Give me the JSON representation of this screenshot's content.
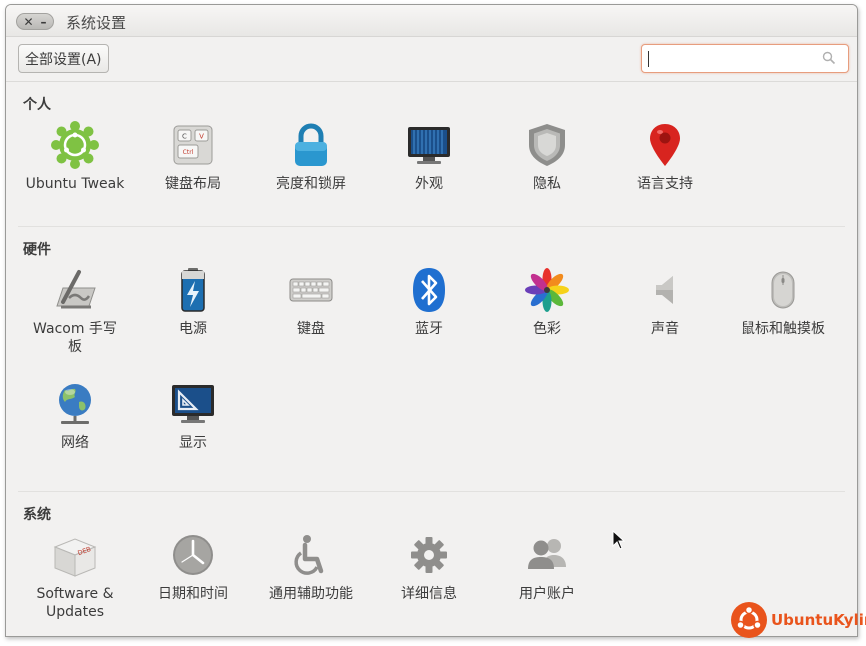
{
  "window": {
    "title": "系统设置",
    "close_glyph": "✕",
    "minimize_glyph": "–"
  },
  "toolbar": {
    "all_settings_label": "全部设置(A)",
    "search_value": "",
    "search_icon": "search-icon"
  },
  "sections": {
    "personal": {
      "title": "个人",
      "items": [
        {
          "label": "Ubuntu Tweak",
          "icon": "ubuntu-tweak-icon"
        },
        {
          "label": "键盘布局",
          "icon": "keyboard-layout-icon"
        },
        {
          "label": "亮度和锁屏",
          "icon": "lock-icon"
        },
        {
          "label": "外观",
          "icon": "monitor-icon"
        },
        {
          "label": "隐私",
          "icon": "shield-icon"
        },
        {
          "label": "语言支持",
          "icon": "map-pin-icon"
        }
      ]
    },
    "hardware": {
      "title": "硬件",
      "items": [
        {
          "label": "Wacom 手写\n板",
          "label_line1": "Wacom 手写",
          "label_line2": "板",
          "icon": "tablet-pen-icon"
        },
        {
          "label": "电源",
          "icon": "battery-icon"
        },
        {
          "label": "键盘",
          "icon": "keyboard-icon"
        },
        {
          "label": "蓝牙",
          "icon": "bluetooth-icon"
        },
        {
          "label": "色彩",
          "icon": "color-flower-icon"
        },
        {
          "label": "声音",
          "icon": "speaker-icon"
        },
        {
          "label": "鼠标和触摸板",
          "icon": "mouse-icon"
        },
        {
          "label": "网络",
          "icon": "globe-network-icon"
        },
        {
          "label": "显示",
          "icon": "display-icon"
        }
      ]
    },
    "system": {
      "title": "系统",
      "items": [
        {
          "label_line1": "Software &",
          "label_line2": "Updates",
          "icon": "deb-package-icon"
        },
        {
          "label": "日期和时间",
          "icon": "clock-icon"
        },
        {
          "label": "通用辅助功能",
          "icon": "accessibility-icon"
        },
        {
          "label": "详细信息",
          "icon": "gear-icon"
        },
        {
          "label": "用户账户",
          "icon": "users-icon"
        }
      ]
    }
  },
  "branding": {
    "text": "UbuntuKylin",
    "color": "#e9541c"
  },
  "colors": {
    "window_bg": "#f2f1f0",
    "search_focus": "#e79d7e",
    "accent": "#e9541c"
  }
}
